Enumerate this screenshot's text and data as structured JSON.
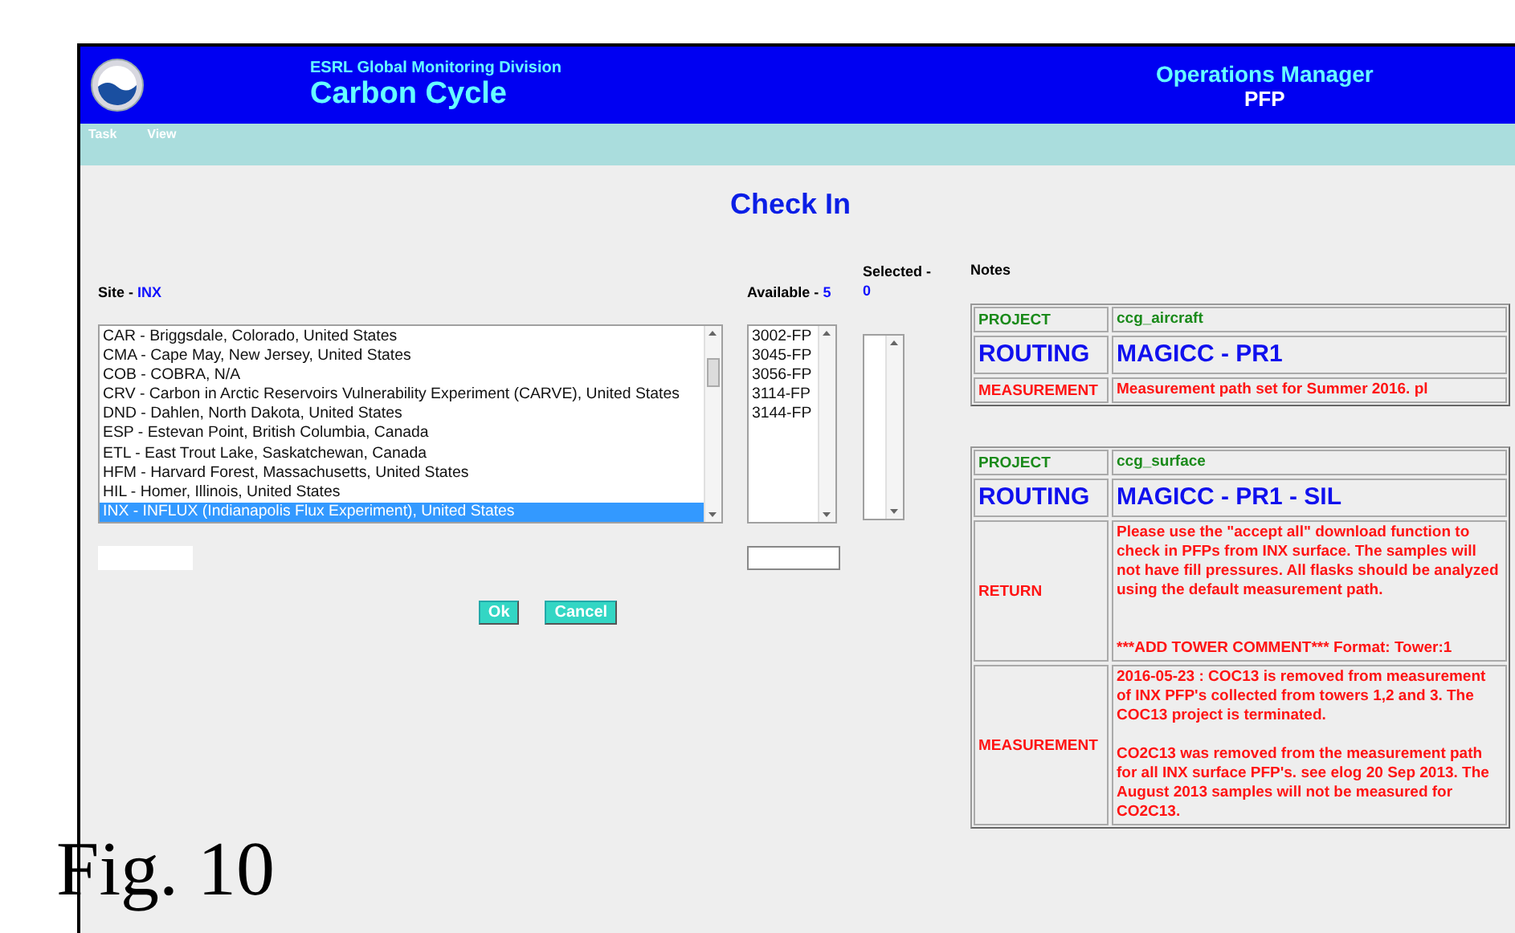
{
  "header": {
    "division": "ESRL Global Monitoring Division",
    "title": "Carbon Cycle",
    "app_title": "Operations Manager",
    "app_subtitle": "PFP"
  },
  "menu": [
    {
      "label": "Task"
    },
    {
      "label": "View"
    }
  ],
  "page_title": "Check In",
  "site": {
    "label": "Site - ",
    "value": "INX",
    "items": [
      {
        "label": "CAR - Briggsdale, Colorado, United States",
        "selected": false
      },
      {
        "label": "CMA - Cape May, New Jersey, United States",
        "selected": false
      },
      {
        "label": "COB - COBRA, N/A",
        "selected": false
      },
      {
        "label": "CRV - Carbon in Arctic Reservoirs Vulnerability Experiment (CARVE), United States",
        "selected": false
      },
      {
        "label": "DND - Dahlen, North Dakota, United States",
        "selected": false
      },
      {
        "label": "ESP - Estevan Point, British Columbia, Canada",
        "selected": false
      },
      {
        "label": "ETL - East Trout Lake, Saskatchewan, Canada",
        "selected": false
      },
      {
        "label": "HFM - Harvard Forest, Massachusetts, United States",
        "selected": false
      },
      {
        "label": "HIL - Homer, Illinois, United States",
        "selected": false
      },
      {
        "label": "INX - INFLUX (Indianapolis Flux Experiment), United States",
        "selected": true
      }
    ]
  },
  "available": {
    "label": "Available - ",
    "count": "5",
    "items": [
      {
        "label": "3002-FP",
        "selected": false
      },
      {
        "label": "3045-FP",
        "selected": false
      },
      {
        "label": "3056-FP",
        "selected": false
      },
      {
        "label": "3114-FP",
        "selected": false
      },
      {
        "label": "3144-FP",
        "selected": false
      }
    ]
  },
  "selected": {
    "label": "Selected - ",
    "count": "0"
  },
  "buttons": [
    {
      "label": "Ok"
    },
    {
      "label": "Cancel"
    }
  ],
  "notes": {
    "label": "Notes",
    "tables": [
      {
        "rows": [
          {
            "kind": "project",
            "label": "PROJECT",
            "paragraphs": [
              "ccg_aircraft"
            ]
          },
          {
            "kind": "routing",
            "label": "ROUTING",
            "paragraphs": [
              "MAGICC - PR1"
            ]
          },
          {
            "kind": "measurement",
            "label": "MEASUREMENT",
            "paragraphs": [
              "Measurement path set for Summer 2016. pl"
            ]
          }
        ]
      },
      {
        "rows": [
          {
            "kind": "project",
            "label": "PROJECT",
            "paragraphs": [
              "ccg_surface"
            ]
          },
          {
            "kind": "routing",
            "label": "ROUTING",
            "paragraphs": [
              "MAGICC - PR1 - SIL"
            ]
          },
          {
            "kind": "return",
            "label": "RETURN",
            "paragraphs": [
              "Please use the \"accept all\" download function to check in PFPs from INX surface. The samples will not have fill pressures. All flasks should be analyzed using the default measurement path.",
              "***ADD TOWER COMMENT*** Format: Tower:1"
            ]
          },
          {
            "kind": "measurement",
            "label": "MEASUREMENT",
            "paragraphs": [
              "2016-05-23 : COC13 is removed from measurement of INX PFP's collected from towers 1,2 and 3. The COC13 project is terminated.",
              "CO2C13 was removed from the measurement path for all INX surface PFP's. see elog 20 Sep 2013. The August 2013 samples will not be measured for CO2C13."
            ]
          }
        ]
      }
    ]
  },
  "caption": "Fig. 10"
}
